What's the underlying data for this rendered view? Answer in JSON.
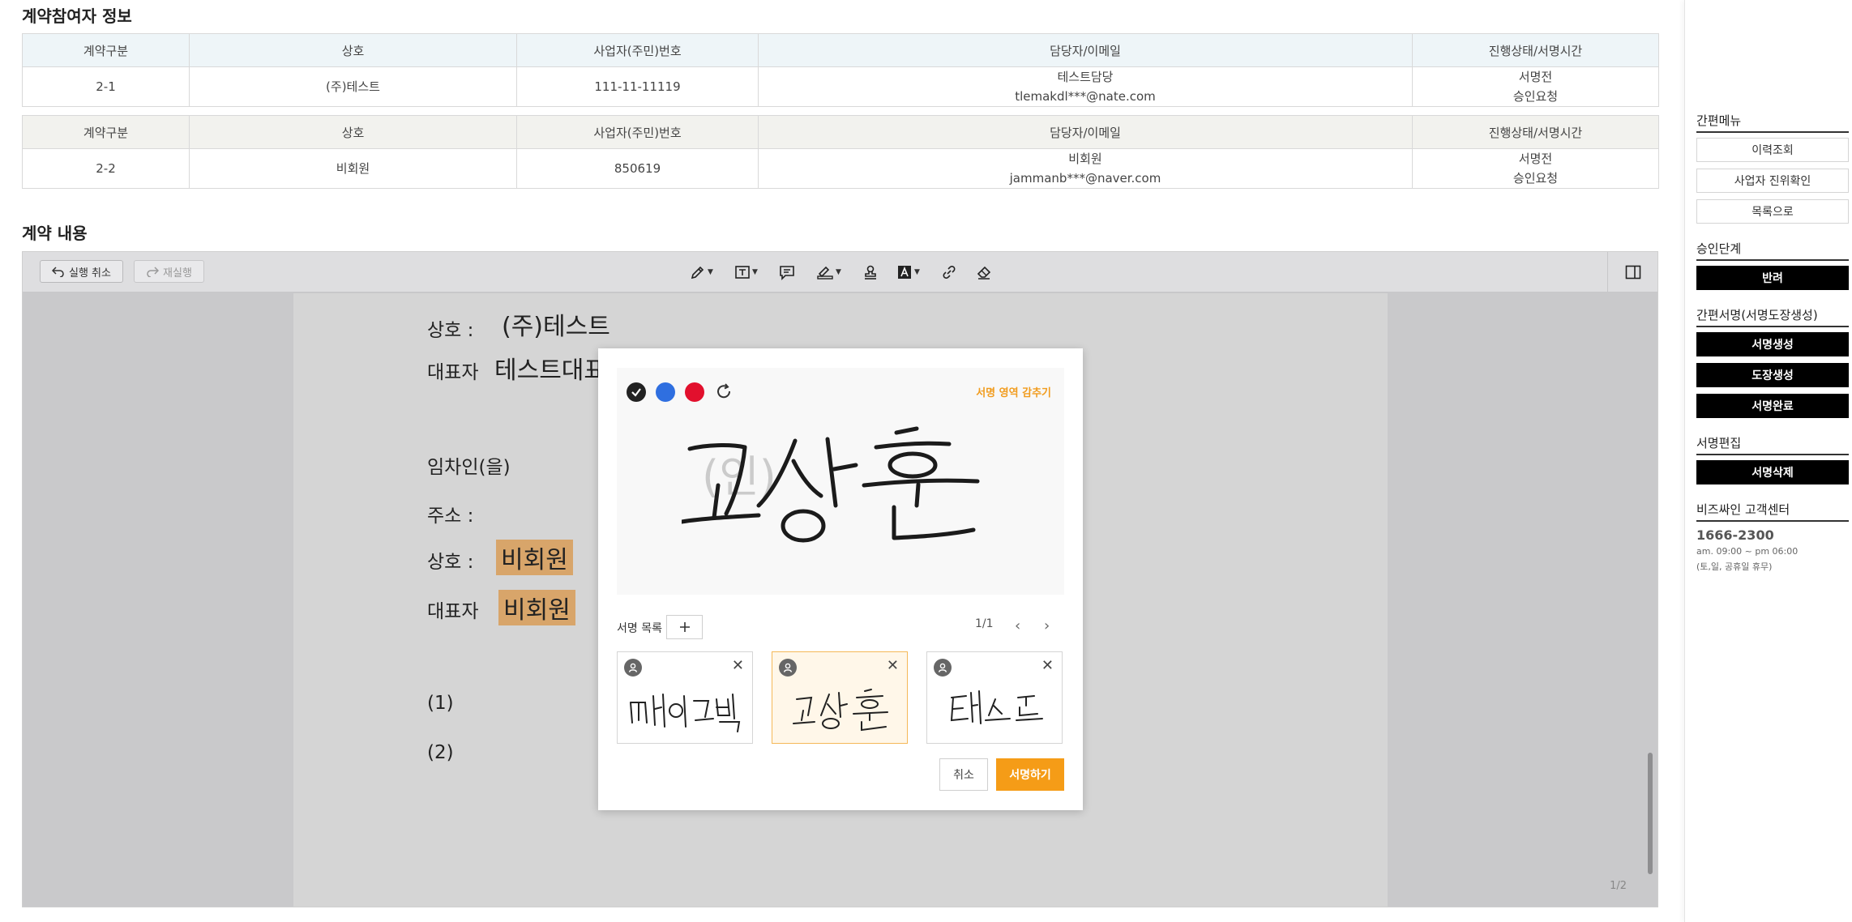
{
  "participants": {
    "title": "계약참여자 정보",
    "headers": [
      "계약구분",
      "상호",
      "사업자(주민)번호",
      "담당자/이메일",
      "진행상태/서명시간"
    ],
    "rows": [
      {
        "type": "2-1",
        "company": "(주)테스트",
        "reg_no": "111-11-11119",
        "contact_name": "테스트담당",
        "contact_email": "tlemakdl***@nate.com",
        "status": "서명전",
        "status_detail": "승인요청"
      },
      {
        "type": "2-2",
        "company": "비회원",
        "reg_no": "850619",
        "contact_name": "비회원",
        "contact_email": "jammanb***@naver.com",
        "status": "서명전",
        "status_detail": "승인요청"
      }
    ]
  },
  "contract": {
    "title": "계약 내용",
    "toolbar": {
      "undo_label": "실행 취소",
      "redo_label": "재실행"
    },
    "doc": {
      "label_company": "상호 :",
      "company_value": "(주)테스트",
      "label_rep": "대표자",
      "rep_value": "테스트대표",
      "lessee": "임차인(을)",
      "label_address": "주소 :",
      "label_company2": "상호 :",
      "company2_value": "비회원",
      "label_rep2": "대표자",
      "rep2_value": "비회원",
      "item1": "(1)",
      "item2": "(2)",
      "colon": ":"
    },
    "page_indicator": "1/2"
  },
  "modal": {
    "hide_area": "서명 영역 감추기",
    "list_label": "서명 목록",
    "pager": "1/1",
    "signature_names": [
      "메이크벌",
      "고상훈",
      "테스트"
    ],
    "cancel_label": "취소",
    "sign_label": "서명하기",
    "colors": {
      "black": "#222222",
      "blue": "#2f6fe0",
      "red": "#e2102d",
      "accent": "#f59c17"
    }
  },
  "sidebar": {
    "quick_menu": {
      "title": "간편메뉴",
      "items": [
        "이력조회",
        "사업자 진위확인",
        "목록으로"
      ]
    },
    "approval": {
      "title": "승인단계",
      "items": [
        "반려"
      ]
    },
    "easy_sign": {
      "title": "간편서명(서명도장생성)",
      "items": [
        "서명생성",
        "도장생성",
        "서명완료"
      ]
    },
    "sign_edit": {
      "title": "서명편집",
      "items": [
        "서명삭제"
      ]
    },
    "support": {
      "title": "비즈싸인 고객센터",
      "phone": "1666-2300",
      "hours": "am. 09:00 ~ pm 06:00",
      "holiday": "(토,일, 공휴일 휴무)"
    }
  }
}
